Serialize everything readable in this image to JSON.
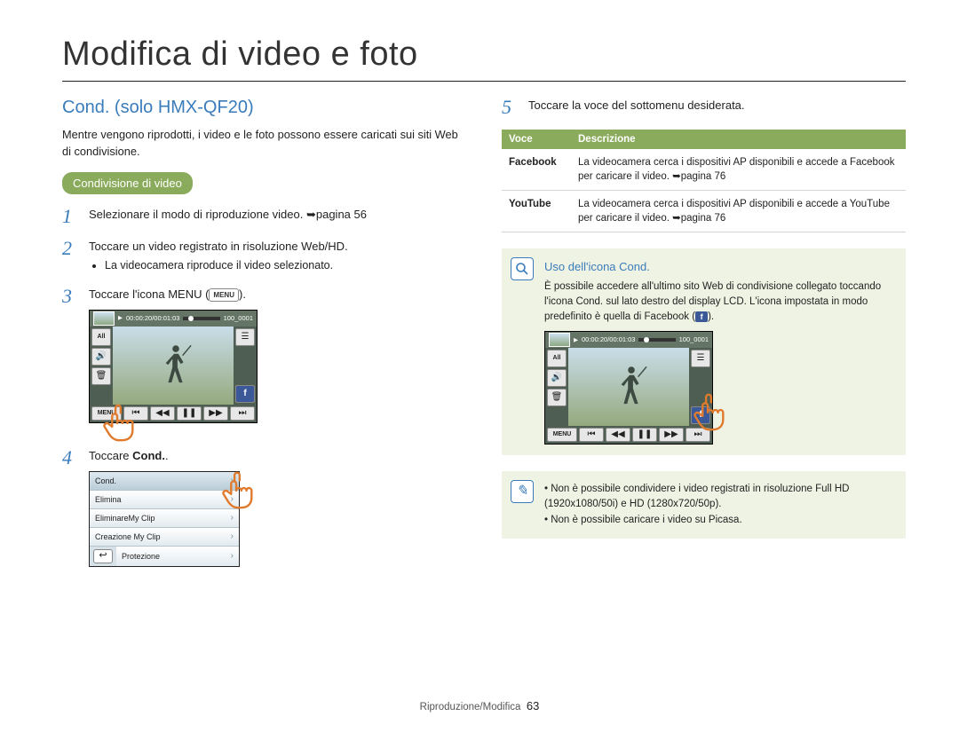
{
  "chapter_title": "Modifica di video e foto",
  "section_title": "Cond. (solo HMX-QF20)",
  "intro": "Mentre vengono riprodotti, i video e le foto possono essere caricati sui siti Web di condivisione.",
  "subhead_pill": "Condivisione di video",
  "steps": {
    "s1": {
      "num": "1",
      "text": "Selezionare il modo di riproduzione video. ➥pagina 56"
    },
    "s2": {
      "num": "2",
      "text": "Toccare un video registrato in risoluzione Web/HD.",
      "bullet": "La videocamera riproduce il video selezionato."
    },
    "s3": {
      "num": "3",
      "text_a": "Toccare l'icona MENU (",
      "text_b": ").",
      "chip": "MENU"
    },
    "s4": {
      "num": "4",
      "text_a": "Toccare ",
      "text_b": "Cond.",
      "text_c": "."
    },
    "s5": {
      "num": "5",
      "text": "Toccare la voce del sottomenu desiderata."
    }
  },
  "playback": {
    "time": "00:00:20/00:01:03",
    "clip": "100_0001",
    "left_all": "All",
    "menu_label": "MENU"
  },
  "menu_popup": {
    "items": [
      "Cond.",
      "Elimina",
      "EliminareMy Clip",
      "Creazione My Clip",
      "Protezione"
    ]
  },
  "table": {
    "h1": "Voce",
    "h2": "Descrizione",
    "r1": {
      "k": "Facebook",
      "v": "La videocamera cerca i dispositivi AP disponibili e accede a Facebook per caricare il video. ➥pagina 76"
    },
    "r2": {
      "k": "YouTube",
      "v": "La videocamera cerca i dispositivi AP disponibili e accede a YouTube per caricare il video. ➥pagina 76"
    }
  },
  "info_box": {
    "title": "Uso dell'icona Cond.",
    "body_a": "È possibile accedere all'ultimo sito Web di condivisione collegato toccando l'icona Cond. sul lato destro del display LCD. L'icona impostata in modo predefinito è quella di Facebook (",
    "body_b": ")."
  },
  "warn_box": {
    "l1": "Non è possibile condividere i video registrati in risoluzione Full HD (1920x1080/50i) e HD (1280x720/50p).",
    "l2": "Non è possibile caricare i video su Picasa."
  },
  "footer": {
    "section": "Riproduzione/Modifica",
    "page": "63"
  }
}
